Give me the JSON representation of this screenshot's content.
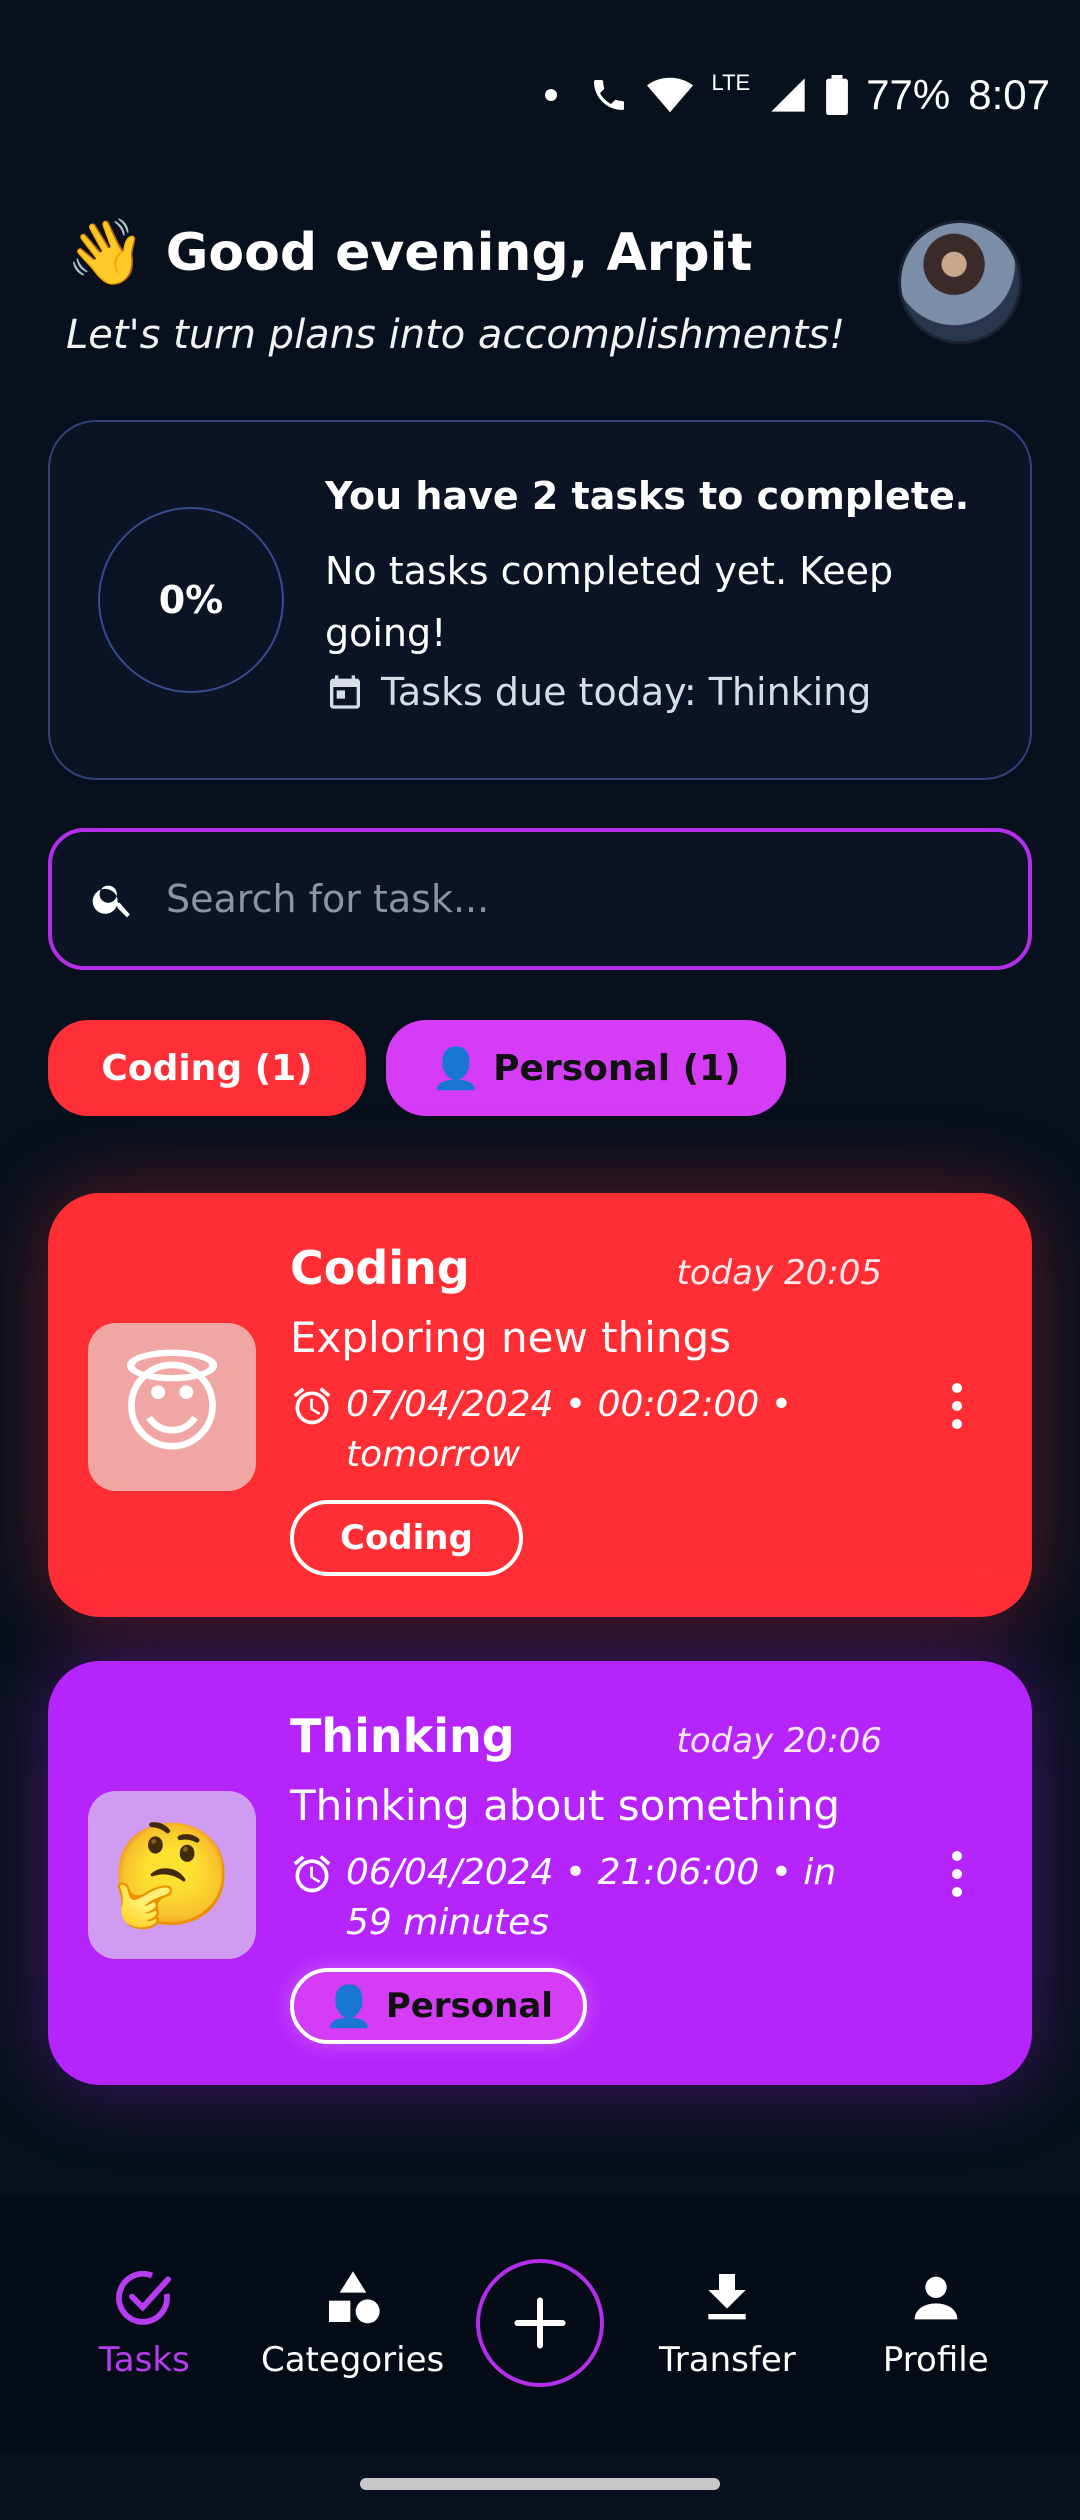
{
  "status_bar": {
    "battery": "77%",
    "time": "8:07",
    "network": "LTE"
  },
  "header": {
    "wave_emoji": "👋",
    "greeting": "Good evening, Arpit",
    "subtitle": "Let's turn plans into accomplishments!"
  },
  "summary": {
    "progress_label": "0%",
    "progress_fraction": 0,
    "title": "You have 2 tasks to complete.",
    "message": "No tasks completed yet. Keep going!",
    "due": "Tasks due today: Thinking"
  },
  "search": {
    "placeholder": "Search for task..."
  },
  "chips": {
    "coding": "Coding (1)",
    "personal_emoji": "👤",
    "personal": "Personal (1)"
  },
  "tasks": [
    {
      "emoji": "😇",
      "name": "Coding",
      "time": "today 20:05",
      "description": "Exploring new things",
      "date": "07/04/2024 • 00:02:00 • tomorrow",
      "tag": "Coding",
      "color": "#ff2d34"
    },
    {
      "emoji": "🤔",
      "name": "Thinking",
      "time": "today 20:06",
      "description": "Thinking about something",
      "date": "06/04/2024 • 21:06:00 • in 59 minutes",
      "tag_emoji": "👤",
      "tag": "Personal",
      "color": "#b524fb"
    }
  ],
  "nav": {
    "tasks": "Tasks",
    "categories": "Categories",
    "transfer": "Transfer",
    "profile": "Profile"
  },
  "colors": {
    "accent": "#b32ee8",
    "background": "#07101c",
    "coding": "#ff2d34",
    "personal": "#d43df5"
  }
}
